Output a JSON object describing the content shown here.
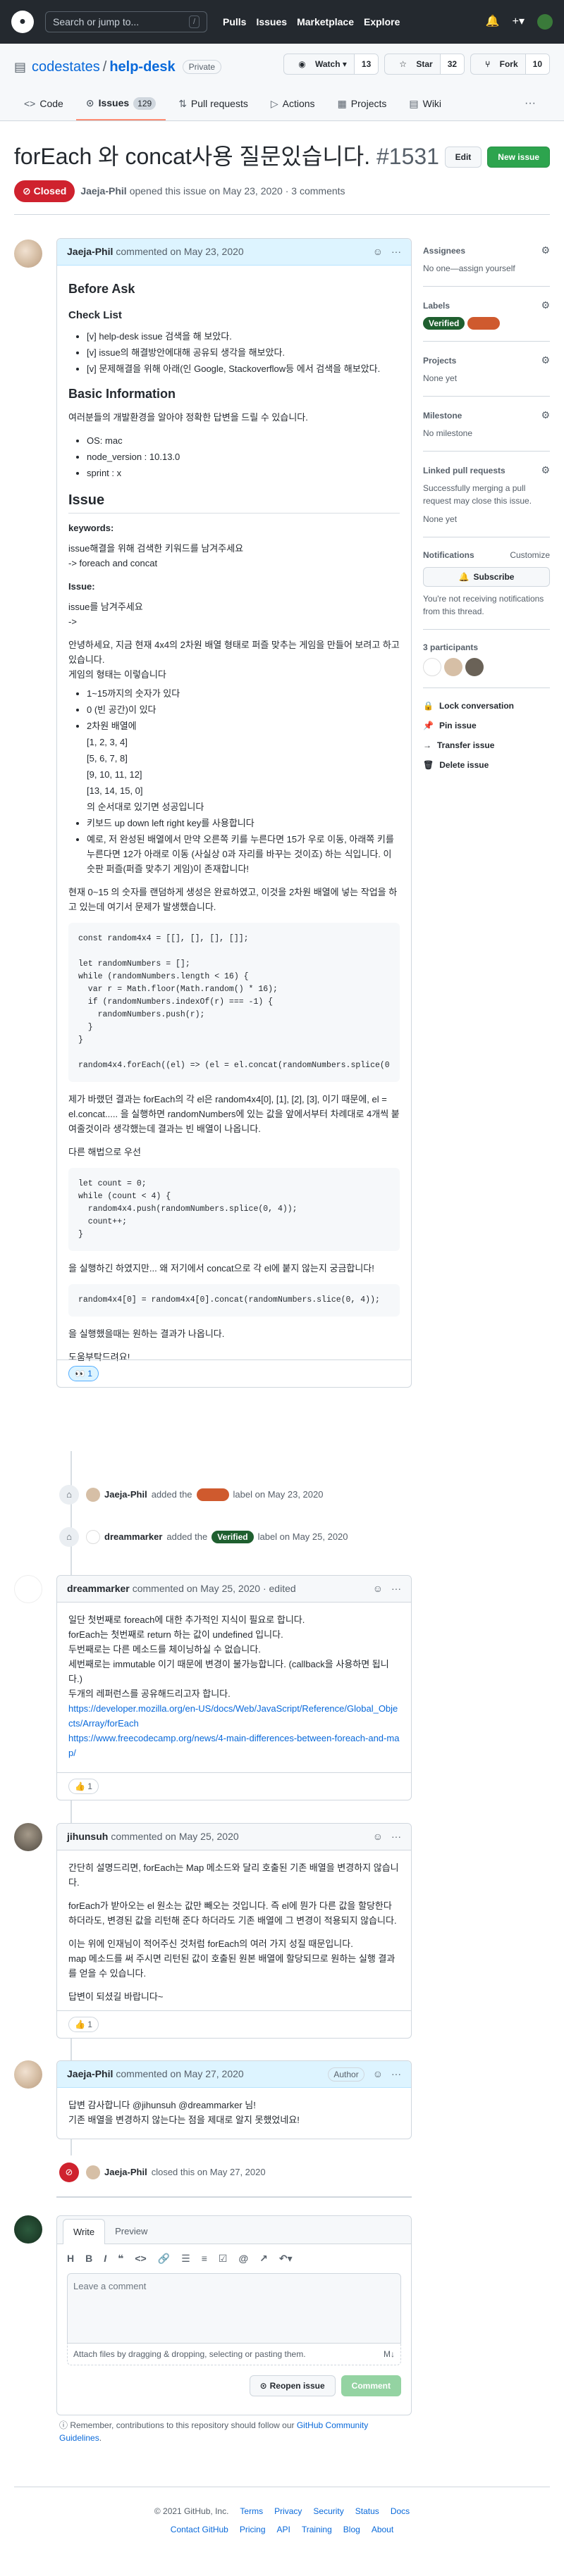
{
  "header": {
    "search_placeholder": "Search or jump to...",
    "search_key": "/",
    "nav": [
      "Pulls",
      "Issues",
      "Marketplace",
      "Explore"
    ]
  },
  "repo": {
    "owner": "codestates",
    "name": "help-desk",
    "visibility": "Private",
    "watch_label": "Watch",
    "watch_count": "13",
    "star_label": "Star",
    "star_count": "32",
    "fork_label": "Fork",
    "fork_count": "10",
    "tabs": [
      {
        "label": "Code",
        "icon": "code-icon"
      },
      {
        "label": "Issues",
        "icon": "issue-icon",
        "count": "129"
      },
      {
        "label": "Pull requests",
        "icon": "pull-request-icon"
      },
      {
        "label": "Actions",
        "icon": "play-icon"
      },
      {
        "label": "Projects",
        "icon": "project-icon"
      },
      {
        "label": "Wiki",
        "icon": "book-icon"
      }
    ]
  },
  "issue": {
    "title": "forEach 와 concat사용 질문있습니다.",
    "number": "#1531",
    "edit_label": "Edit",
    "new_issue_label": "New issue",
    "state": "Closed",
    "author": "Jaeja-Phil",
    "meta": "opened this issue on May 23, 2020 · 3 comments"
  },
  "first_comment": {
    "author": "Jaeja-Phil",
    "meta": "commented on May 23, 2020",
    "h_before": "Before Ask",
    "h_check": "Check List",
    "checklist": [
      "[v] help-desk issue 검색을 해 보았다.",
      "[v] issue의 해결방안에대해 공유되 생각을 해보았다.",
      "[v] 문제해결을 위해 아래(인 Google, Stackoverflow등 에서 검색을 해보았다."
    ],
    "h_basic": "Basic Information",
    "basic_intro": "여러분들의 개발환경을 알아야 정확한 답변을 드릴 수 있습니다.",
    "basic_list": [
      "OS: mac",
      "node_version : 10.13.0",
      "sprint : x"
    ],
    "h_issue": "Issue",
    "keywords_label": "keywords:",
    "keywords_text1": "issue해결을 위해 검색한 키워드를 남겨주세요",
    "keywords_text2": "-> foreach and concat",
    "issue_label": "Issue:",
    "issue_text1": "issue를 남겨주세요",
    "issue_text2": "->",
    "para1": "안녕하세요, 지금 현재 4x4의 2차원 배열 형태로 퍼즐 맞추는 게임을 만들어 보려고 하고 있습니다.",
    "para2": "게임의 형태는 이렇습니다",
    "game_list": [
      "1~15까지의 숫자가 있다",
      "0 (빈 공간)이 있다",
      "2차원 배열에",
      "[1, 2, 3, 4]",
      "[5, 6, 7, 8]",
      "[9, 10, 11, 12]",
      "[13, 14, 15, 0]",
      "의 순서대로 있기면 성공입니다",
      "키보드 up down left right key를 사용합니다",
      "예로, 저 완성된 배열에서 만약 오른쪽 키를 누른다면 15가 우로 이동, 아래쪽 키를 누른다면 12가 아래로 이동 (사실상 0과 자리를 바꾸는 것이죠) 하는 식입니다. 이 숫판 퍼즐(퍼즐 맞추기 게임)이 존재합니다!"
    ],
    "para3": "현재 0~15 의 숫자를 랜덤하게 생성은 완료하였고, 이것을 2차원 배열에 넣는 작업을 하고 있는데 여기서 문제가 발생했습니다.",
    "code1": "const random4x4 = [[], [], [], []];\n\nlet randomNumbers = [];\nwhile (randomNumbers.length < 16) {\n  var r = Math.floor(Math.random() * 16);\n  if (randomNumbers.indexOf(r) === -1) {\n    randomNumbers.push(r);\n  }\n}\n\nrandom4x4.forEach((el) => (el = el.concat(randomNumbers.splice(0",
    "para4": "제가 바랬던 결과는 forEach의 각 el은 random4x4[0], [1], [2], [3], 이기 때문에, el = el.concat..... 을 실행하면 randomNumbers에 있는 값을 앞에서부터 차례대로 4개씩 붙여줄것이라 생각했는데 결과는 빈 배열이 나옵니다.",
    "para5": "다른 해법으로 우선",
    "code2": "let count = 0;\nwhile (count < 4) {\n  random4x4.push(randomNumbers.splice(0, 4));\n  count++;\n}",
    "para6": "을 실행하긴 하였지만... 왜 저기에서 concat으로 각 el에 붙지 않는지 궁금합니다!",
    "code3": "random4x4[0] = random4x4[0].concat(randomNumbers.slice(0, 4));",
    "para7": "을 실행했을때는 원하는 결과가 나옵니다.",
    "para8": "도움부탁드려요!",
    "reaction_count": "1"
  },
  "event_label": {
    "actor": "Jaeja-Phil",
    "action": "added the",
    "label_name": "",
    "label_color": "#cf5a2e",
    "suffix": "label on May 23, 2020"
  },
  "event_verified": {
    "actor": "dreammarker",
    "action": "added the",
    "label_name": "Verified",
    "label_color": "#1f5f2f",
    "suffix": "label on May 25, 2020"
  },
  "comment2": {
    "author": "dreammarker",
    "meta": "commented on May 25, 2020 · edited",
    "lines": [
      "일단 첫번째로 foreach에 대한 추가적인 지식이 필요로 합니다.",
      "forEach는 첫번째로 return 하는 값이 undefined 입니다.",
      "두번째로는 다른 메소드를 체이닝하실 수 없습니다.",
      "세번째로는 immutable 이기 때문에 변경이 불가능합니다. (callback을 사용하면 됩니다.)",
      "두개의 레퍼런스를 공유해드리고자 합니다."
    ],
    "link1": "https://developer.mozilla.org/en-US/docs/Web/JavaScript/Reference/Global_Objects/Array/forEach",
    "link2": "https://www.freecodecamp.org/news/4-main-differences-between-foreach-and-map/",
    "reaction_count": "1"
  },
  "comment3": {
    "author": "jihunsuh",
    "meta": "commented on May 25, 2020",
    "p1": "간단히 설명드리면, forEach는 Map 메소드와 달리 호출된 기존 배열을 변경하지 않습니다.",
    "p2": "forEach가 받아오는 el 원소는 값만 빼오는 것입니다. 즉 el에 뭔가 다른 값을 할당한다 하더라도, 변경된 값을 리턴해 준다 하더라도 기존 배열에 그 변경이 적용되지 않습니다.",
    "p3": "이는 위에 인재님이 적어주신 것처럼 forEach의 여러 가지 성질 때문입니다.",
    "p4": "map 메소드를 써 주시면 리턴된 값이 호출된 원본 배열에 할당되므로 원하는 실행 결과를 얻을 수 있습니다.",
    "p5": "답변이 되셨길 바랍니다~",
    "reaction_count": "1"
  },
  "comment4": {
    "author": "Jaeja-Phil",
    "meta": "commented on May 27, 2020",
    "badge": "Author",
    "p1": "답변 감사합니다 @jihunsuh @dreammarker 님!",
    "p2": "기존 배열을 변경하지 않는다는 점을 제대로 알지 못했었네요!"
  },
  "event_closed": {
    "actor": "Jaeja-Phil",
    "text": "closed this on May 27, 2020"
  },
  "form": {
    "tab_write": "Write",
    "tab_preview": "Preview",
    "placeholder": "Leave a comment",
    "attach": "Attach files by dragging & dropping, selecting or pasting them.",
    "reopen": "Reopen issue",
    "comment": "Comment",
    "note_prefix": "Remember, contributions to this repository should follow our",
    "note_link": "GitHub Community Guidelines",
    "note_suffix": "."
  },
  "sidebar": {
    "assignees_title": "Assignees",
    "assignees_val": "No one—assign yourself",
    "labels_title": "Labels",
    "labels": [
      {
        "name": "Verified",
        "color": "#1f5f2f"
      },
      {
        "name": "",
        "color": "#cf5a2e"
      }
    ],
    "projects_title": "Projects",
    "projects_val": "None yet",
    "milestone_title": "Milestone",
    "milestone_val": "No milestone",
    "linked_title": "Linked pull requests",
    "linked_desc": "Successfully merging a pull request may close this issue.",
    "linked_val": "None yet",
    "notif_title": "Notifications",
    "notif_customize": "Customize",
    "subscribe": "Subscribe",
    "notif_desc": "You're not receiving notifications from this thread.",
    "participants_title": "3 participants",
    "lock": "Lock conversation",
    "pin": "Pin issue",
    "transfer": "Transfer issue",
    "delete": "Delete issue"
  },
  "footer": {
    "copyright": "© 2021 GitHub, Inc.",
    "row1": [
      "Terms",
      "Privacy",
      "Security",
      "Status",
      "Docs"
    ],
    "row2": [
      "Contact GitHub",
      "Pricing",
      "API",
      "Training",
      "Blog",
      "About"
    ]
  }
}
